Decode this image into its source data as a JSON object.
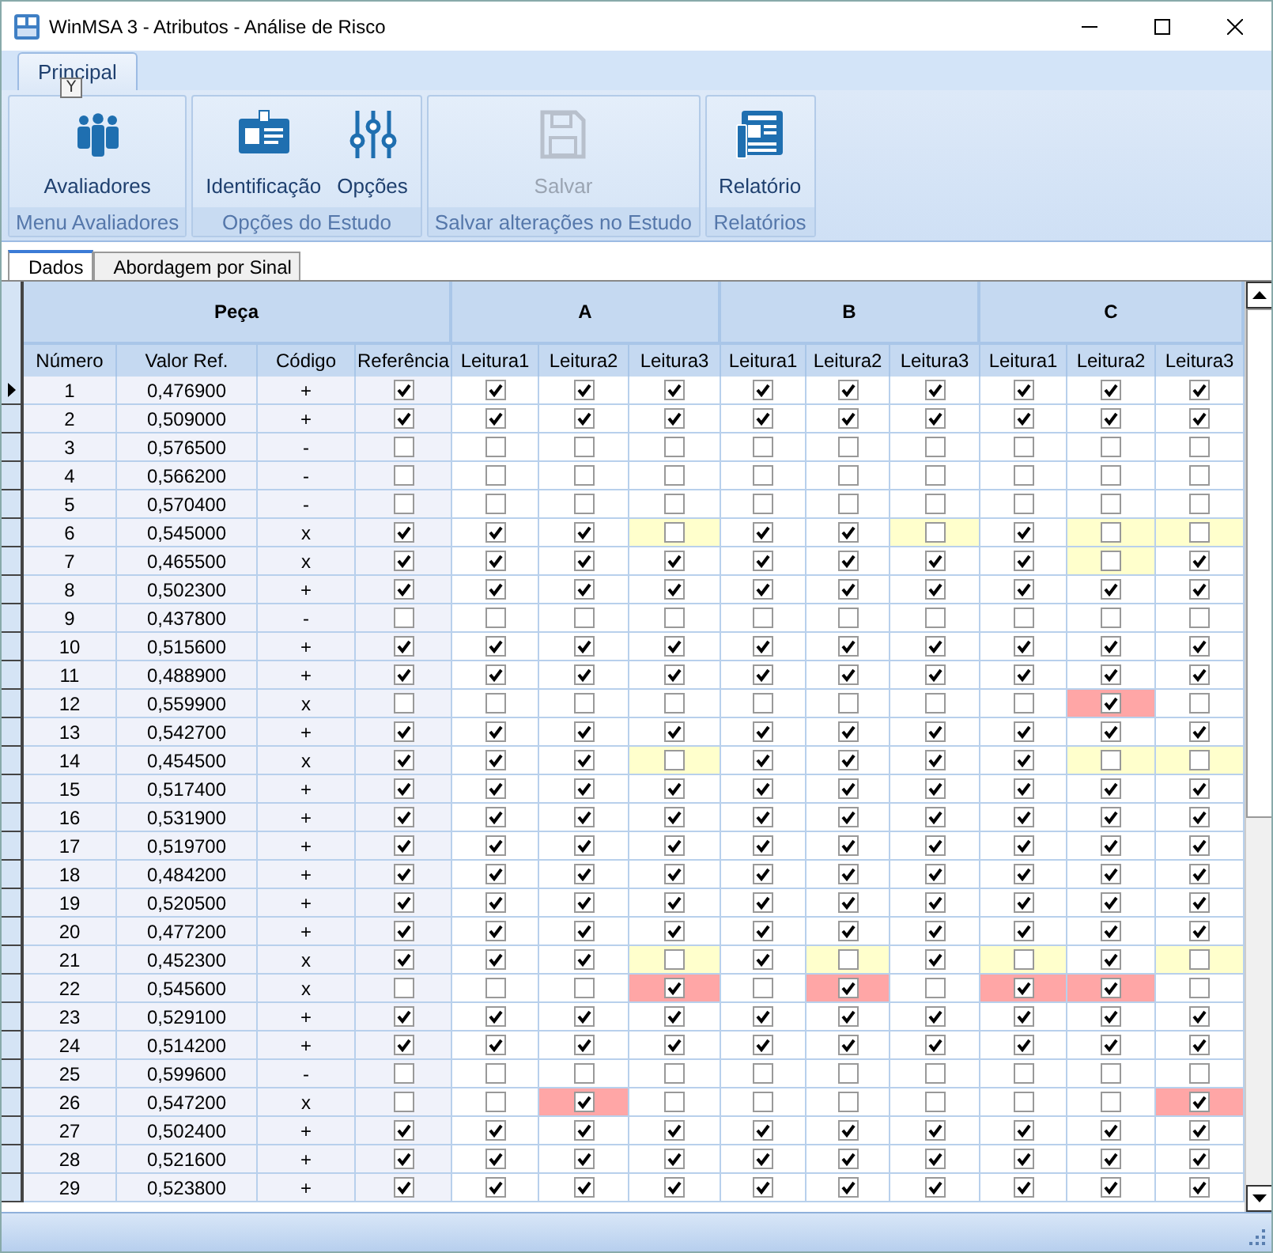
{
  "window": {
    "title": "WinMSA 3 - Atributos - Análise de Risco"
  },
  "ribbon": {
    "tabs": [
      {
        "label": "Principal",
        "selected": true
      }
    ],
    "key_tip": "Y",
    "groups": [
      {
        "label": "Menu Avaliadores",
        "buttons": [
          {
            "label": "Avaliadores",
            "disabled": false
          }
        ]
      },
      {
        "label": "Opções do Estudo",
        "buttons": [
          {
            "label": "Identificação",
            "disabled": false
          },
          {
            "label": "Opções",
            "disabled": false
          }
        ]
      },
      {
        "label": "Salvar alterações no Estudo",
        "buttons": [
          {
            "label": "Salvar",
            "disabled": true
          }
        ]
      },
      {
        "label": "Relatórios",
        "buttons": [
          {
            "label": "Relatório",
            "disabled": false
          }
        ]
      }
    ]
  },
  "sheet_tabs": [
    {
      "label": "Dados",
      "selected": true
    },
    {
      "label": "Abordagem por Sinal",
      "selected": false
    }
  ],
  "table": {
    "groups": [
      "Peça",
      "A",
      "B",
      "C"
    ],
    "columns": [
      "Número",
      "Valor Ref.",
      "Código",
      "Referência",
      "Leitura1",
      "Leitura2",
      "Leitura3",
      "Leitura1",
      "Leitura2",
      "Leitura3",
      "Leitura1",
      "Leitura2",
      "Leitura3"
    ],
    "rows": [
      {
        "numero": "1",
        "valor_ref": "0,476900",
        "codigo": "+",
        "selected": true,
        "referencia": true,
        "readings": [
          true,
          true,
          true,
          true,
          true,
          true,
          true,
          true,
          true
        ]
      },
      {
        "numero": "2",
        "valor_ref": "0,509000",
        "codigo": "+",
        "selected": false,
        "referencia": true,
        "readings": [
          true,
          true,
          true,
          true,
          true,
          true,
          true,
          true,
          true
        ]
      },
      {
        "numero": "3",
        "valor_ref": "0,576500",
        "codigo": "-",
        "selected": false,
        "referencia": false,
        "readings": [
          false,
          false,
          false,
          false,
          false,
          false,
          false,
          false,
          false
        ]
      },
      {
        "numero": "4",
        "valor_ref": "0,566200",
        "codigo": "-",
        "selected": false,
        "referencia": false,
        "readings": [
          false,
          false,
          false,
          false,
          false,
          false,
          false,
          false,
          false
        ]
      },
      {
        "numero": "5",
        "valor_ref": "0,570400",
        "codigo": "-",
        "selected": false,
        "referencia": false,
        "readings": [
          false,
          false,
          false,
          false,
          false,
          false,
          false,
          false,
          false
        ]
      },
      {
        "numero": "6",
        "valor_ref": "0,545000",
        "codigo": "x",
        "selected": false,
        "referencia": true,
        "readings": [
          true,
          true,
          false,
          true,
          true,
          false,
          true,
          false,
          false
        ]
      },
      {
        "numero": "7",
        "valor_ref": "0,465500",
        "codigo": "x",
        "selected": false,
        "referencia": true,
        "readings": [
          true,
          true,
          true,
          true,
          true,
          true,
          true,
          false,
          true
        ]
      },
      {
        "numero": "8",
        "valor_ref": "0,502300",
        "codigo": "+",
        "selected": false,
        "referencia": true,
        "readings": [
          true,
          true,
          true,
          true,
          true,
          true,
          true,
          true,
          true
        ]
      },
      {
        "numero": "9",
        "valor_ref": "0,437800",
        "codigo": "-",
        "selected": false,
        "referencia": false,
        "readings": [
          false,
          false,
          false,
          false,
          false,
          false,
          false,
          false,
          false
        ]
      },
      {
        "numero": "10",
        "valor_ref": "0,515600",
        "codigo": "+",
        "selected": false,
        "referencia": true,
        "readings": [
          true,
          true,
          true,
          true,
          true,
          true,
          true,
          true,
          true
        ]
      },
      {
        "numero": "11",
        "valor_ref": "0,488900",
        "codigo": "+",
        "selected": false,
        "referencia": true,
        "readings": [
          true,
          true,
          true,
          true,
          true,
          true,
          true,
          true,
          true
        ]
      },
      {
        "numero": "12",
        "valor_ref": "0,559900",
        "codigo": "x",
        "selected": false,
        "referencia": false,
        "readings": [
          false,
          false,
          false,
          false,
          false,
          false,
          false,
          true,
          false
        ]
      },
      {
        "numero": "13",
        "valor_ref": "0,542700",
        "codigo": "+",
        "selected": false,
        "referencia": true,
        "readings": [
          true,
          true,
          true,
          true,
          true,
          true,
          true,
          true,
          true
        ]
      },
      {
        "numero": "14",
        "valor_ref": "0,454500",
        "codigo": "x",
        "selected": false,
        "referencia": true,
        "readings": [
          true,
          true,
          false,
          true,
          true,
          true,
          true,
          false,
          false
        ]
      },
      {
        "numero": "15",
        "valor_ref": "0,517400",
        "codigo": "+",
        "selected": false,
        "referencia": true,
        "readings": [
          true,
          true,
          true,
          true,
          true,
          true,
          true,
          true,
          true
        ]
      },
      {
        "numero": "16",
        "valor_ref": "0,531900",
        "codigo": "+",
        "selected": false,
        "referencia": true,
        "readings": [
          true,
          true,
          true,
          true,
          true,
          true,
          true,
          true,
          true
        ]
      },
      {
        "numero": "17",
        "valor_ref": "0,519700",
        "codigo": "+",
        "selected": false,
        "referencia": true,
        "readings": [
          true,
          true,
          true,
          true,
          true,
          true,
          true,
          true,
          true
        ]
      },
      {
        "numero": "18",
        "valor_ref": "0,484200",
        "codigo": "+",
        "selected": false,
        "referencia": true,
        "readings": [
          true,
          true,
          true,
          true,
          true,
          true,
          true,
          true,
          true
        ]
      },
      {
        "numero": "19",
        "valor_ref": "0,520500",
        "codigo": "+",
        "selected": false,
        "referencia": true,
        "readings": [
          true,
          true,
          true,
          true,
          true,
          true,
          true,
          true,
          true
        ]
      },
      {
        "numero": "20",
        "valor_ref": "0,477200",
        "codigo": "+",
        "selected": false,
        "referencia": true,
        "readings": [
          true,
          true,
          true,
          true,
          true,
          true,
          true,
          true,
          true
        ]
      },
      {
        "numero": "21",
        "valor_ref": "0,452300",
        "codigo": "x",
        "selected": false,
        "referencia": true,
        "readings": [
          true,
          true,
          false,
          true,
          false,
          true,
          false,
          true,
          false
        ]
      },
      {
        "numero": "22",
        "valor_ref": "0,545600",
        "codigo": "x",
        "selected": false,
        "referencia": false,
        "readings": [
          false,
          false,
          true,
          false,
          true,
          false,
          true,
          true,
          false
        ]
      },
      {
        "numero": "23",
        "valor_ref": "0,529100",
        "codigo": "+",
        "selected": false,
        "referencia": true,
        "readings": [
          true,
          true,
          true,
          true,
          true,
          true,
          true,
          true,
          true
        ]
      },
      {
        "numero": "24",
        "valor_ref": "0,514200",
        "codigo": "+",
        "selected": false,
        "referencia": true,
        "readings": [
          true,
          true,
          true,
          true,
          true,
          true,
          true,
          true,
          true
        ]
      },
      {
        "numero": "25",
        "valor_ref": "0,599600",
        "codigo": "-",
        "selected": false,
        "referencia": false,
        "readings": [
          false,
          false,
          false,
          false,
          false,
          false,
          false,
          false,
          false
        ]
      },
      {
        "numero": "26",
        "valor_ref": "0,547200",
        "codigo": "x",
        "selected": false,
        "referencia": false,
        "readings": [
          false,
          true,
          false,
          false,
          false,
          false,
          false,
          false,
          true
        ]
      },
      {
        "numero": "27",
        "valor_ref": "0,502400",
        "codigo": "+",
        "selected": false,
        "referencia": true,
        "readings": [
          true,
          true,
          true,
          true,
          true,
          true,
          true,
          true,
          true
        ]
      },
      {
        "numero": "28",
        "valor_ref": "0,521600",
        "codigo": "+",
        "selected": false,
        "referencia": true,
        "readings": [
          true,
          true,
          true,
          true,
          true,
          true,
          true,
          true,
          true
        ]
      },
      {
        "numero": "29",
        "valor_ref": "0,523800",
        "codigo": "+",
        "selected": false,
        "referencia": true,
        "readings": [
          true,
          true,
          true,
          true,
          true,
          true,
          true,
          true,
          true
        ]
      }
    ]
  }
}
